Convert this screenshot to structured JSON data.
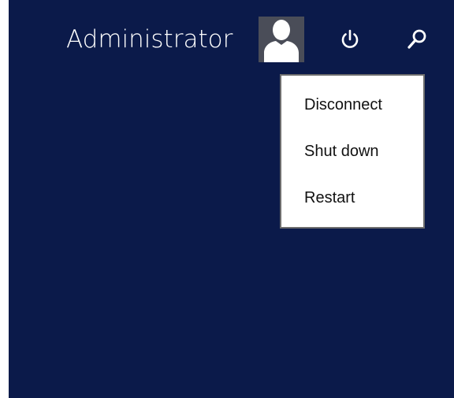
{
  "user": {
    "name": "Administrator",
    "avatar_icon": "user-avatar-icon"
  },
  "toolbar": {
    "power_icon": "power-icon",
    "search_icon": "search-icon"
  },
  "power_menu": {
    "items": [
      {
        "label": "Disconnect"
      },
      {
        "label": "Shut down"
      },
      {
        "label": "Restart"
      }
    ]
  },
  "colors": {
    "background": "#0b1a4a",
    "avatar_bg": "#4a4d58",
    "menu_bg": "#ffffff",
    "menu_border": "#6d6d6d",
    "text_light": "#ffffff",
    "text_dark": "#111111"
  }
}
